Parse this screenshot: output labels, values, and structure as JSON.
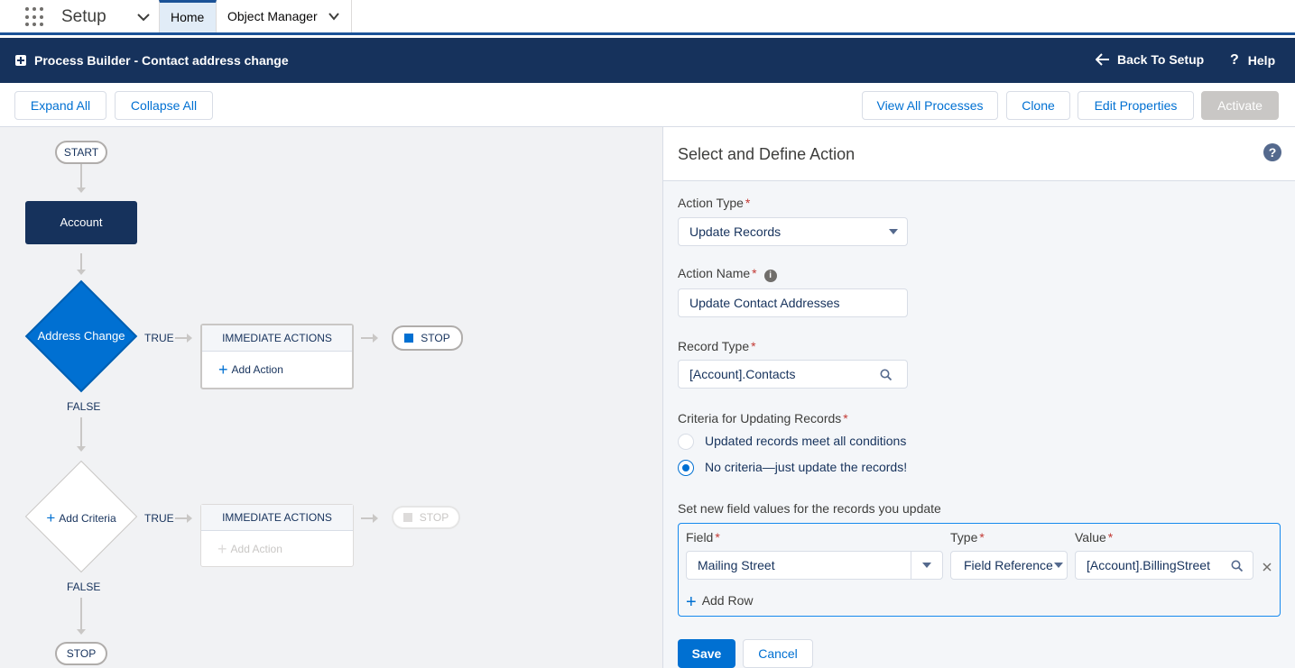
{
  "nav": {
    "app_name": "Setup",
    "tabs": [
      {
        "label": "Home"
      },
      {
        "label": "Object Manager"
      }
    ]
  },
  "header": {
    "title": "Process Builder - Contact address change",
    "back_label": "Back To Setup",
    "help_label": "Help"
  },
  "toolbar": {
    "expand_all": "Expand All",
    "collapse_all": "Collapse All",
    "view_all_processes": "View All Processes",
    "clone": "Clone",
    "edit_properties": "Edit Properties",
    "activate": "Activate"
  },
  "canvas": {
    "start_label": "START",
    "object_node": "Account",
    "criteria_1": {
      "label": "Address Change",
      "true_label": "TRUE",
      "false_label": "FALSE",
      "actions_header": "IMMEDIATE ACTIONS",
      "add_action": "Add Action",
      "stop_label": "STOP"
    },
    "criteria_2": {
      "label": "Add Criteria",
      "true_label": "TRUE",
      "false_label": "FALSE",
      "actions_header": "IMMEDIATE ACTIONS",
      "add_action": "Add Action",
      "stop_label": "STOP"
    },
    "end_stop_label": "STOP"
  },
  "panel": {
    "title": "Select and Define Action",
    "action_type": {
      "label": "Action Type",
      "value": "Update Records"
    },
    "action_name": {
      "label": "Action Name",
      "value": "Update Contact Addresses"
    },
    "record_type": {
      "label": "Record Type",
      "value": "[Account].Contacts"
    },
    "criteria": {
      "label": "Criteria for Updating Records",
      "options": [
        {
          "label": "Updated records meet all conditions",
          "selected": false
        },
        {
          "label": "No criteria—just update the records!",
          "selected": true
        }
      ]
    },
    "field_values": {
      "label": "Set new field values for the records you update",
      "col_field": "Field",
      "col_type": "Type",
      "col_value": "Value",
      "rows": [
        {
          "field": "Mailing Street",
          "type": "Field Reference",
          "value": "[Account].BillingStreet"
        }
      ],
      "add_row": "Add Row"
    },
    "save": "Save",
    "cancel": "Cancel"
  },
  "colors": {
    "brand_navy": "#16325c",
    "accent_blue": "#0070d2",
    "required_red": "#c23934"
  }
}
